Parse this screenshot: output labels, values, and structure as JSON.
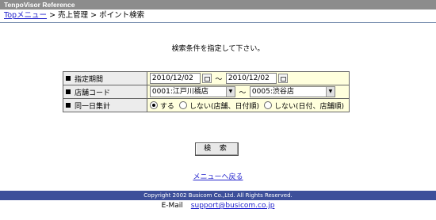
{
  "header": {
    "title": "TenpoVisor Reference"
  },
  "breadcrumb": {
    "home": "Topメニュー",
    "sep1": " > ",
    "section": "売上管理",
    "sep2": " > ",
    "current": "ポイント検索"
  },
  "instruction": "検索条件を指定して下さい。",
  "form": {
    "period": {
      "label": "指定期間",
      "from": "2010/12/02",
      "sep": "～",
      "to": "2010/12/02"
    },
    "store": {
      "label": "店舗コード",
      "from": "0001:江戸川橋店",
      "sep": "～",
      "to": "0005:渋谷店"
    },
    "aggregate": {
      "label": "同一日集計",
      "options": [
        "する",
        "しない(店舗、日付順)",
        "しない(日付、店舗順)"
      ],
      "selected": "する"
    }
  },
  "search_button": "検 索",
  "back_link": "メニューへ戻る",
  "footer": {
    "copyright": "Copyright 2002 Busicom Co.,Ltd. All Rights Reserved."
  },
  "contact": {
    "label": "E-Mail",
    "email": "support@busicom.co.jp"
  }
}
